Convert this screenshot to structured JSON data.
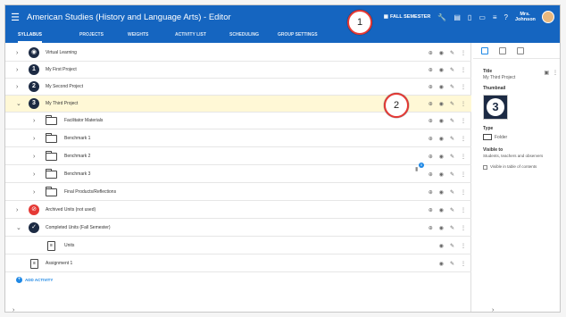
{
  "app": {
    "title": "American Studies (History and Language Arts) - Editor",
    "semester_label": "FALL SEMESTER",
    "user_name": "Mrs. Johnson"
  },
  "tabs": [
    {
      "label": "SYLLABUS",
      "active": true
    },
    {
      "label": "PROJECTS"
    },
    {
      "label": "WEIGHTS"
    },
    {
      "label": "ACTIVITY LIST"
    },
    {
      "label": "SCHEDULING"
    },
    {
      "label": "GROUP SETTINGS"
    }
  ],
  "rows": [
    {
      "label": "Virtual Learning"
    },
    {
      "label": "My First Project",
      "number": "1"
    },
    {
      "label": "My Second Project",
      "number": "2"
    },
    {
      "label": "My Third Project",
      "number": "3"
    },
    {
      "label": "Facilitator Materials"
    },
    {
      "label": "Benchmark 1"
    },
    {
      "label": "Benchmark 2"
    },
    {
      "label": "Benchmark 3",
      "badge_count": "0"
    },
    {
      "label": "Final Products/Reflections"
    },
    {
      "label": "Archived Units (not used)"
    },
    {
      "label": "Completed Units (Fall Semester)"
    },
    {
      "label": "Units"
    },
    {
      "label": "Assignment 1"
    }
  ],
  "add_activity": "ADD ACTIVITY",
  "panel": {
    "title_label": "Title",
    "title_value": "My Third Project",
    "thumbnail_label": "Thumbnail",
    "thumbnail_number": "3",
    "type_label": "Type",
    "type_value": "Folder",
    "visible_label": "Visible to",
    "visible_value": "Students, teachers and observers",
    "toc_label": "Visible in table of contents"
  },
  "callouts": [
    "1",
    "2"
  ],
  "colors": {
    "primary": "#1565c0",
    "accent": "#1e88e5",
    "selected_row": "#fff8d6",
    "callout_border": "#e53935"
  }
}
